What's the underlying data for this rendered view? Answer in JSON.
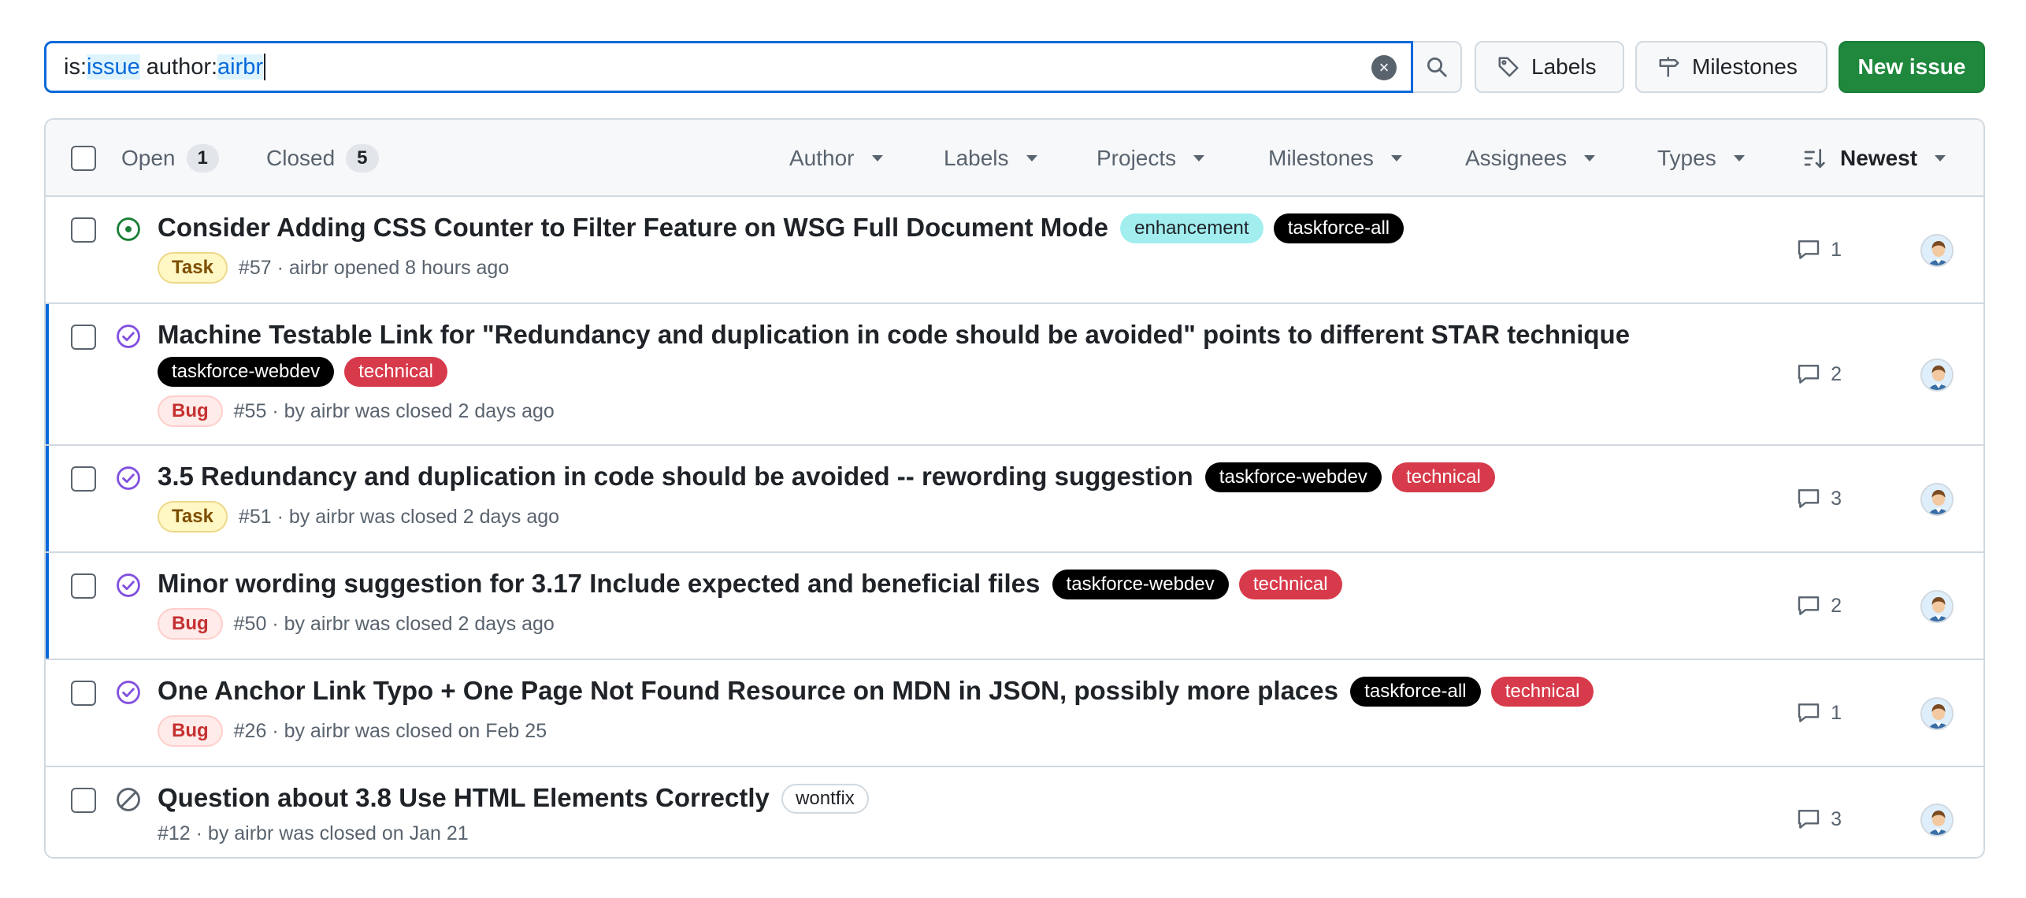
{
  "search": {
    "query_parts": [
      {
        "text": "is:",
        "kind": "key"
      },
      {
        "text": "issue",
        "kind": "val"
      },
      {
        "text": " author:",
        "kind": "key"
      },
      {
        "text": "airbr",
        "kind": "val"
      }
    ]
  },
  "toolbar": {
    "labels_label": "Labels",
    "milestones_label": "Milestones",
    "new_issue_label": "New issue"
  },
  "header": {
    "open_label": "Open",
    "open_count": "1",
    "closed_label": "Closed",
    "closed_count": "5",
    "filters": [
      "Author",
      "Labels",
      "Projects",
      "Milestones",
      "Assignees",
      "Types"
    ],
    "sort_label": "Newest"
  },
  "colors": {
    "accent": "#0969da",
    "primary_button": "#1f883d",
    "open_state": "#1a7f37",
    "closed_state": "#8250df",
    "not_planned_state": "#59636e"
  },
  "issues": [
    {
      "state": "open",
      "title": "Consider Adding CSS Counter to Filter Feature on WSG Full Document Mode",
      "labels": [
        {
          "text": "enhancement",
          "style": "enh"
        },
        {
          "text": "taskforce-all",
          "style": "dark"
        }
      ],
      "type": "Task",
      "meta": "#57 · airbr opened 8 hours ago",
      "comments": "1"
    },
    {
      "state": "closed",
      "title": "Machine Testable Link for \"Redundancy and duplication in code should be avoided\" points to different STAR technique",
      "labels": [
        {
          "text": "taskforce-webdev",
          "style": "dark"
        },
        {
          "text": "technical",
          "style": "tech"
        }
      ],
      "type": "Bug",
      "meta": "#55 · by airbr was closed 2 days ago",
      "comments": "2"
    },
    {
      "state": "closed",
      "title": "3.5 Redundancy and duplication in code should be avoided -- rewording suggestion",
      "labels": [
        {
          "text": "taskforce-webdev",
          "style": "dark"
        },
        {
          "text": "technical",
          "style": "tech"
        }
      ],
      "type": "Task",
      "meta": "#51 · by airbr was closed 2 days ago",
      "comments": "3"
    },
    {
      "state": "closed",
      "title": "Minor wording suggestion for 3.17 Include expected and beneficial files",
      "labels": [
        {
          "text": "taskforce-webdev",
          "style": "dark"
        },
        {
          "text": "technical",
          "style": "tech"
        }
      ],
      "type": "Bug",
      "meta": "#50 · by airbr was closed 2 days ago",
      "comments": "2"
    },
    {
      "state": "closed",
      "title": "One Anchor Link Typo + One Page Not Found Resource on MDN in JSON, possibly more places",
      "labels": [
        {
          "text": "taskforce-all",
          "style": "dark"
        },
        {
          "text": "technical",
          "style": "tech"
        }
      ],
      "type": "Bug",
      "meta": "#26 · by airbr was closed on Feb 25",
      "comments": "1"
    },
    {
      "state": "not-planned",
      "title": "Question about 3.8 Use HTML Elements Correctly",
      "labels": [
        {
          "text": "wontfix",
          "style": "wont"
        }
      ],
      "type": "",
      "meta": "#12 · by airbr was closed on Jan 21",
      "comments": "3"
    }
  ]
}
